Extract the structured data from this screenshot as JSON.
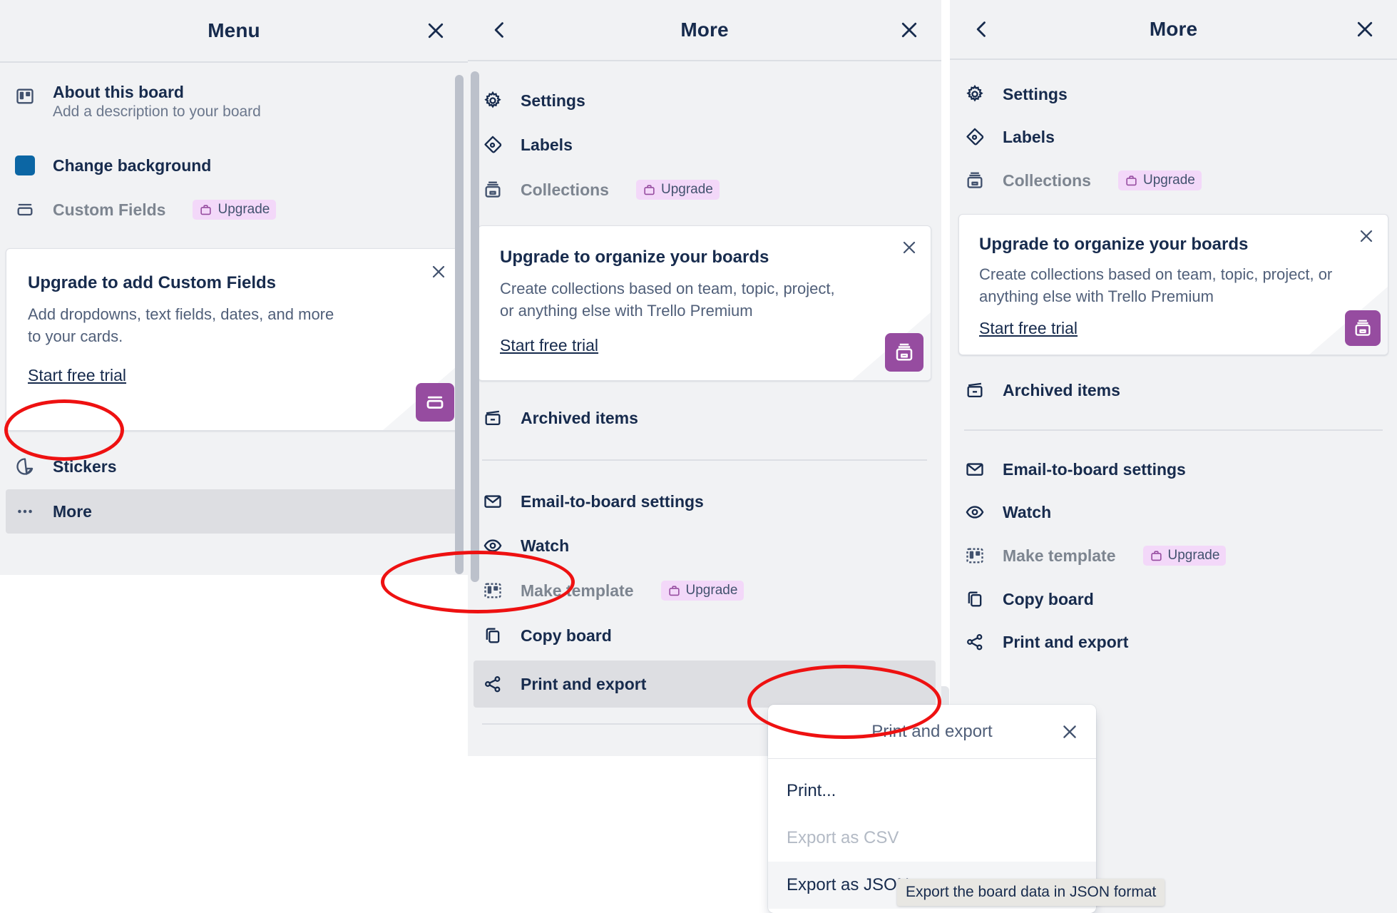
{
  "left_panel": {
    "header": {
      "title": "Menu",
      "close_icon": "close-icon"
    },
    "items": [
      {
        "label": "About this board",
        "sub": "Add a description to your board",
        "icon": "board-icon"
      },
      {
        "label": "Change background",
        "icon": "background-swatch-icon",
        "swatch": "#0c66a4"
      },
      {
        "label": "Custom Fields",
        "icon": "custom-fields-icon",
        "badge": "Upgrade",
        "muted": true
      }
    ],
    "promo": {
      "title": "Upgrade to add Custom Fields",
      "body": "Add dropdowns, text fields, dates, and more to your cards.",
      "link": "Start free trial",
      "close_icon": "close-icon",
      "art_icon": "custom-fields-icon"
    },
    "items_after": [
      {
        "label": "Stickers",
        "icon": "sticker-icon"
      },
      {
        "label": "More",
        "icon": "ellipsis-icon",
        "selected": true
      }
    ]
  },
  "middle_panel": {
    "header": {
      "title": "More",
      "back_icon": "chevron-left-icon",
      "close_icon": "close-icon"
    },
    "items_top": [
      {
        "label": "Settings",
        "icon": "gear-icon"
      },
      {
        "label": "Labels",
        "icon": "label-tag-icon"
      },
      {
        "label": "Collections",
        "icon": "collections-icon",
        "badge": "Upgrade",
        "muted": true
      }
    ],
    "promo": {
      "title": "Upgrade to organize your boards",
      "body": "Create collections based on team, topic, project, or anything else with Trello Premium",
      "link": "Start free trial",
      "close_icon": "close-icon",
      "art_icon": "collections-icon"
    },
    "items_mid": [
      {
        "label": "Archived items",
        "icon": "archive-icon"
      }
    ],
    "items_bottom": [
      {
        "label": "Email-to-board settings",
        "icon": "envelope-icon"
      },
      {
        "label": "Watch",
        "icon": "eye-icon"
      },
      {
        "label": "Make template",
        "icon": "template-icon",
        "badge": "Upgrade",
        "muted": true
      },
      {
        "label": "Copy board",
        "icon": "copy-icon"
      },
      {
        "label": "Print and export",
        "icon": "share-icon",
        "selected": true
      }
    ]
  },
  "right_panel": {
    "header": {
      "title": "More",
      "back_icon": "chevron-left-icon",
      "close_icon": "close-icon"
    },
    "items_top": [
      {
        "label": "Settings",
        "icon": "gear-icon"
      },
      {
        "label": "Labels",
        "icon": "label-tag-icon"
      },
      {
        "label": "Collections",
        "icon": "collections-icon",
        "badge": "Upgrade",
        "muted": true
      }
    ],
    "promo": {
      "title": "Upgrade to organize your boards",
      "body": "Create collections based on team, topic, project, or anything else with Trello Premium",
      "link": "Start free trial",
      "close_icon": "close-icon",
      "art_icon": "collections-icon"
    },
    "items_mid": [
      {
        "label": "Archived items",
        "icon": "archive-icon"
      }
    ],
    "items_bottom": [
      {
        "label": "Email-to-board settings",
        "icon": "envelope-icon"
      },
      {
        "label": "Watch",
        "icon": "eye-icon"
      },
      {
        "label": "Make template",
        "icon": "template-icon",
        "badge": "Upgrade",
        "muted": true
      },
      {
        "label": "Copy board",
        "icon": "copy-icon"
      },
      {
        "label": "Print and export",
        "icon": "share-icon"
      }
    ],
    "popover": {
      "title": "Print and export",
      "close_icon": "close-icon",
      "rows": [
        {
          "label": "Print...",
          "disabled": false
        },
        {
          "label": "Export as CSV",
          "disabled": true
        },
        {
          "label": "Export as JSON",
          "disabled": false,
          "hovered": true
        }
      ],
      "tooltip": "Export the board data in JSON format"
    }
  },
  "colors": {
    "panel_bg": "#f1f2f4",
    "accent_blue": "#0c66a4",
    "badge_bg": "#f3d8f9",
    "badge_icon": "#964ca0",
    "annotation": "#ee1111",
    "text_primary": "#172b4d",
    "text_muted": "#6b778c"
  }
}
